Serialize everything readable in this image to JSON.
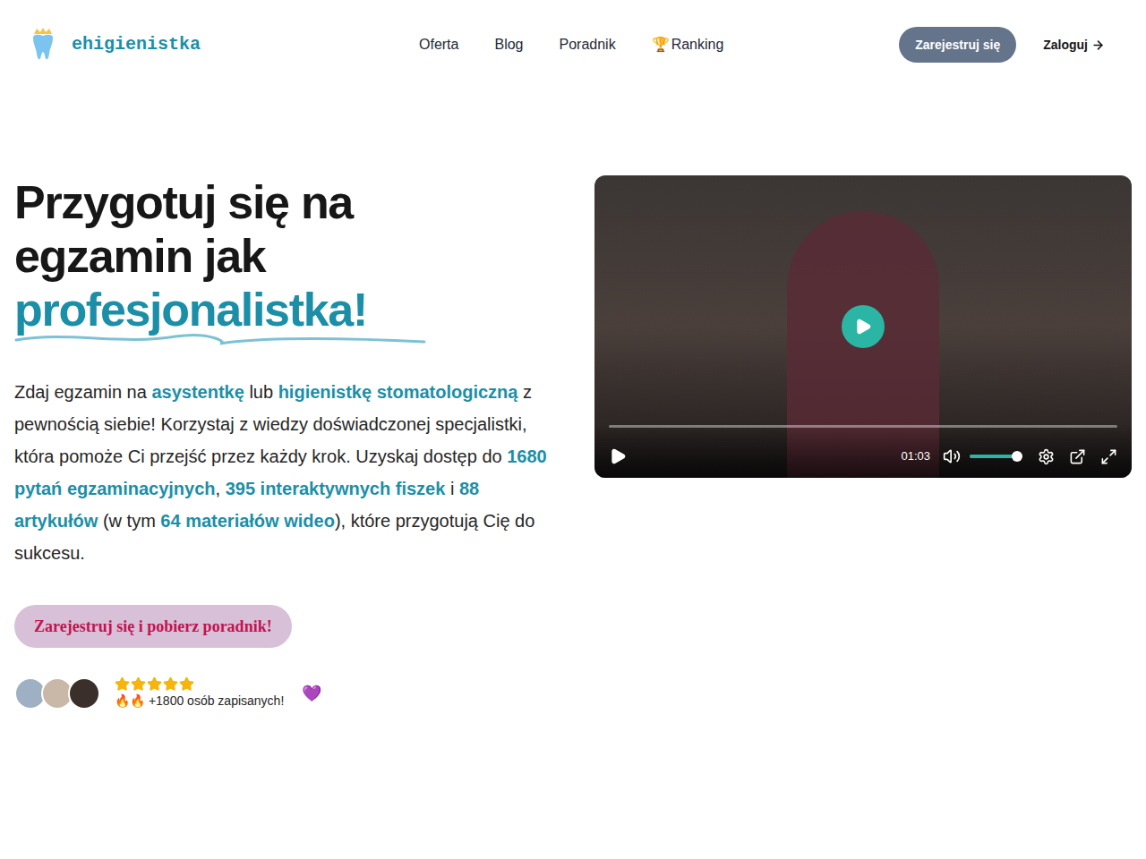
{
  "header": {
    "logo": "ehigienistka",
    "nav": [
      {
        "label": "Oferta",
        "icon": ""
      },
      {
        "label": "Blog",
        "icon": ""
      },
      {
        "label": "Poradnik",
        "icon": ""
      },
      {
        "label": "Ranking",
        "icon": "🏆"
      }
    ],
    "register_button": "Zarejestruj się",
    "login": "Zaloguj"
  },
  "hero": {
    "title_lines": [
      "Przygotuj się na",
      "egzamin jak"
    ],
    "title_accent": "profesjonalistka!",
    "description": [
      {
        "text": "Zdaj egzamin na ",
        "highlight": false
      },
      {
        "text": "asystentkę",
        "highlight": true
      },
      {
        "text": " lub ",
        "highlight": false
      },
      {
        "text": "higienistkę stomatologiczną",
        "highlight": true
      },
      {
        "text": " z pewnością siebie! Korzystaj z wiedzy doświadczonej specjalistki, która pomoże Ci przejść przez każdy krok. Uzyskaj dostęp do ",
        "highlight": false
      },
      {
        "text": "1680 pytań egzaminacyjnych",
        "highlight": true
      },
      {
        "text": ", ",
        "highlight": false
      },
      {
        "text": "395 interaktywnych fiszek",
        "highlight": true
      },
      {
        "text": " i ",
        "highlight": false
      },
      {
        "text": "88 artykułów",
        "highlight": true
      },
      {
        "text": " (w tym ",
        "highlight": false
      },
      {
        "text": "64 materiałów wideo",
        "highlight": true
      },
      {
        "text": "), które przygotują Cię do sukcesu.",
        "highlight": false
      }
    ],
    "cta": "Zarejestruj się i pobierz poradnik!",
    "social_proof": {
      "avatars": [
        {
          "color": "#9fb0c4"
        },
        {
          "color": "#c9b8a8"
        },
        {
          "color": "#3a2f2a"
        }
      ],
      "stars": 5,
      "count_text": "🔥🔥 +1800 osób zapisanych!",
      "heart": "💜"
    }
  },
  "video": {
    "playing": false,
    "progress": {
      "level": 0.0
    },
    "time": "01:03",
    "volume": {
      "level": 0.95,
      "muted": false
    }
  }
}
